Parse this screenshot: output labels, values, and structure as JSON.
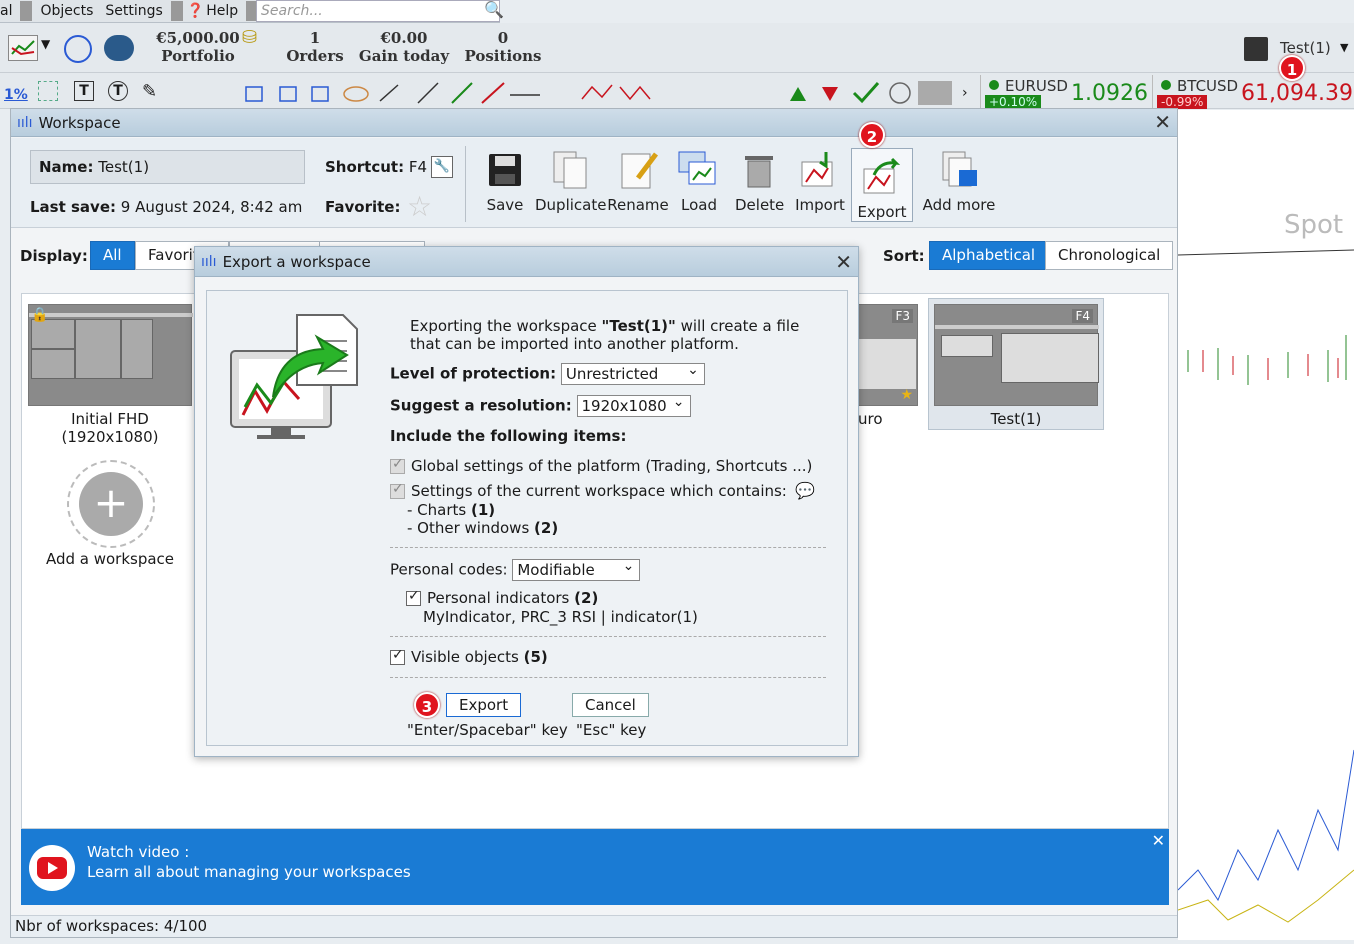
{
  "menu": {
    "items": [
      "al",
      "Objects",
      "Settings",
      "Help"
    ],
    "search_placeholder": "Search..."
  },
  "topbar": {
    "portfolio_value": "€5,000.00",
    "portfolio_label": "Portfolio",
    "orders_value": "1",
    "orders_label": "Orders",
    "gain_value": "€0.00",
    "gain_label": "Gain today",
    "positions_value": "0",
    "positions_label": "Positions",
    "workspace_name": "Test(1)"
  },
  "tickers": [
    {
      "symbol": "EURUSD",
      "change": "+0.10%",
      "price": "1.0926",
      "color": "#1a8a1a"
    },
    {
      "symbol": "BTCUSD",
      "change": "-0.99%",
      "price": "61,094.39",
      "color": "#c8141e"
    }
  ],
  "toolrow": {
    "pct": "1%",
    "text_tool": "T"
  },
  "workspace": {
    "title": "Workspace",
    "name_label": "Name:",
    "name_value": "Test(1)",
    "shortcut_label": "Shortcut:",
    "shortcut_value": "F4",
    "last_save_label": "Last save:",
    "last_save_value": "9 August 2024, 8:42 am",
    "favorite_label": "Favorite:",
    "toolbar": [
      "Save",
      "Duplicate",
      "Rename",
      "Load",
      "Delete",
      "Import",
      "Export",
      "Add more"
    ],
    "display_label": "Display:",
    "display_all": "All",
    "display_fav": "Favorit",
    "sort_label": "Sort:",
    "sort_alpha": "Alphabetical",
    "sort_chrono": "Chronological",
    "cards": [
      {
        "name": "Initial FHD",
        "sub": "(1920x1080)"
      },
      {
        "name": "uro",
        "key": "F3"
      },
      {
        "name": "Test(1)",
        "key": "F4"
      }
    ],
    "add_label": "Add a workspace",
    "banner_title": "Watch video :",
    "banner_text": "Learn all about managing your workspaces",
    "footer": "Nbr of workspaces: 4/100",
    "chart_label": "Spot"
  },
  "dialog": {
    "title": "Export a workspace",
    "intro_prefix": "Exporting the workspace ",
    "intro_name": "\"Test(1)\"",
    "intro_suffix": " will create a file",
    "intro_line2": "that can be imported into another platform.",
    "protection_label": "Level of protection:",
    "protection_value": "Unrestricted",
    "resolution_label": "Suggest a resolution:",
    "resolution_value": "1920x1080",
    "include_label": "Include the following items:",
    "global_settings": "Global settings of the platform (Trading, Shortcuts ...)",
    "current_settings": "Settings of the current workspace which contains:",
    "charts_item": "- Charts",
    "charts_count": "(1)",
    "other_item": "- Other windows",
    "other_count": "(2)",
    "personal_codes_label": "Personal codes:",
    "personal_codes_value": "Modifiable",
    "personal_indicators": "Personal indicators",
    "personal_indicators_count": "(2)",
    "indicator_list": "MyIndicator, PRC_3 RSI | indicator(1)",
    "visible_objects": "Visible objects",
    "visible_objects_count": "(5)",
    "export_btn": "Export",
    "export_hint": "\"Enter/Spacebar\" key",
    "cancel_btn": "Cancel",
    "cancel_hint": "\"Esc\" key"
  },
  "badges": [
    "1",
    "2",
    "3"
  ]
}
